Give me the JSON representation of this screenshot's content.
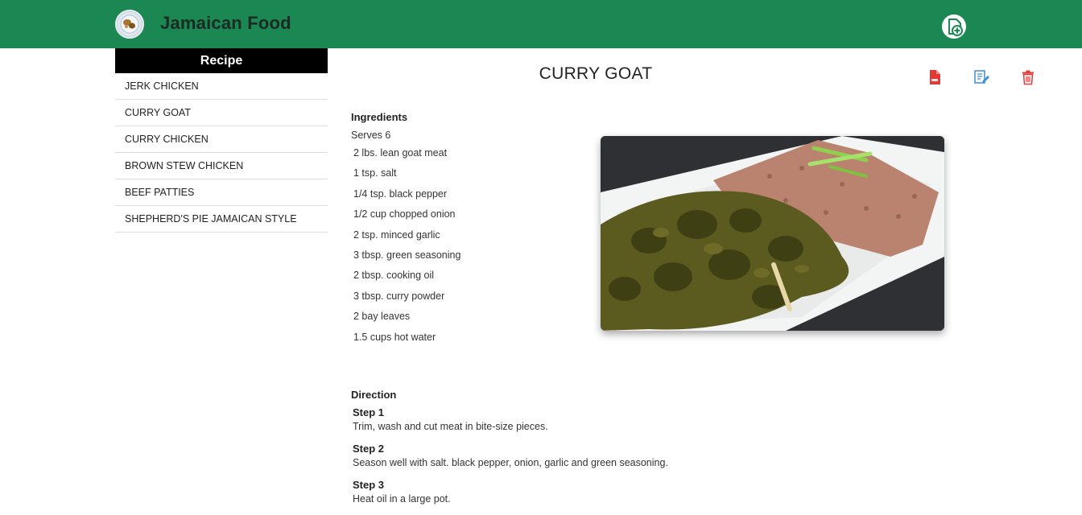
{
  "app": {
    "title": "Jamaican Food"
  },
  "header": {
    "add_icon": "add-document-icon",
    "logo_icon": "food-plate-logo"
  },
  "sidebar": {
    "heading": "Recipe",
    "items": [
      {
        "label": "JERK CHICKEN"
      },
      {
        "label": "CURRY GOAT"
      },
      {
        "label": "CURRY CHICKEN"
      },
      {
        "label": "BROWN STEW CHICKEN"
      },
      {
        "label": "BEEF PATTIES"
      },
      {
        "label": "SHEPHERD'S PIE JAMAICAN STYLE"
      }
    ]
  },
  "recipe": {
    "title": "CURRY GOAT",
    "actions": [
      {
        "icon": "pdf-icon",
        "color": "#e53935"
      },
      {
        "icon": "edit-icon",
        "color": "#3a8fd6"
      },
      {
        "icon": "trash-icon",
        "color": "#e53935"
      }
    ],
    "ingredients_heading": "Ingredients",
    "serves": "Serves 6",
    "ingredients": [
      "2 lbs. lean goat meat",
      "1 tsp. salt",
      "1/4 tsp. black pepper",
      "1/2 cup chopped onion",
      "2 tsp. minced garlic",
      "3 tbsp. green seasoning",
      "2 tbsp. cooking oil",
      "3 tbsp. curry powder",
      "2 bay leaves",
      "1.5 cups hot water"
    ],
    "direction_heading": "Direction",
    "steps": [
      {
        "title": "Step 1",
        "text": "Trim, wash and cut meat in bite-size pieces."
      },
      {
        "title": "Step 2",
        "text": "Season well with salt. black pepper, onion, garlic and green seasoning."
      },
      {
        "title": "Step 3",
        "text": "Heat oil in a large pot."
      }
    ]
  },
  "colors": {
    "brand": "#1b8753",
    "sidebar_header": "#000000"
  }
}
